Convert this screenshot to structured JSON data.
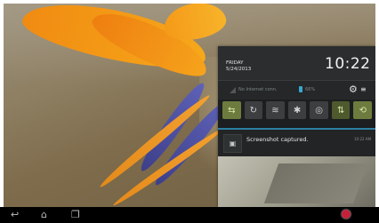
{
  "notification_panel": {
    "day": "FRIDAY",
    "date": "5/24/2013",
    "time": "10:22",
    "network_status": "No Internet conn.",
    "battery": "66%",
    "toggles": [
      {
        "name": "screen-rotate-icon",
        "glyph": "⇆"
      },
      {
        "name": "sync-icon",
        "glyph": "↻"
      },
      {
        "name": "wifi-icon",
        "glyph": "≋"
      },
      {
        "name": "bluetooth-icon",
        "glyph": "✱"
      },
      {
        "name": "location-icon",
        "glyph": "◎"
      },
      {
        "name": "data-icon",
        "glyph": "⇅"
      },
      {
        "name": "auto-rotate-icon",
        "glyph": "⟲"
      }
    ],
    "notification": {
      "title": "Screenshot captured.",
      "time": "10:22 AM"
    }
  },
  "navbar": {
    "back_glyph": "↩",
    "home_glyph": "⌂",
    "recent_glyph": "❐"
  },
  "colors": {
    "accent": "#2c7fa3",
    "record": "#c4203a"
  }
}
